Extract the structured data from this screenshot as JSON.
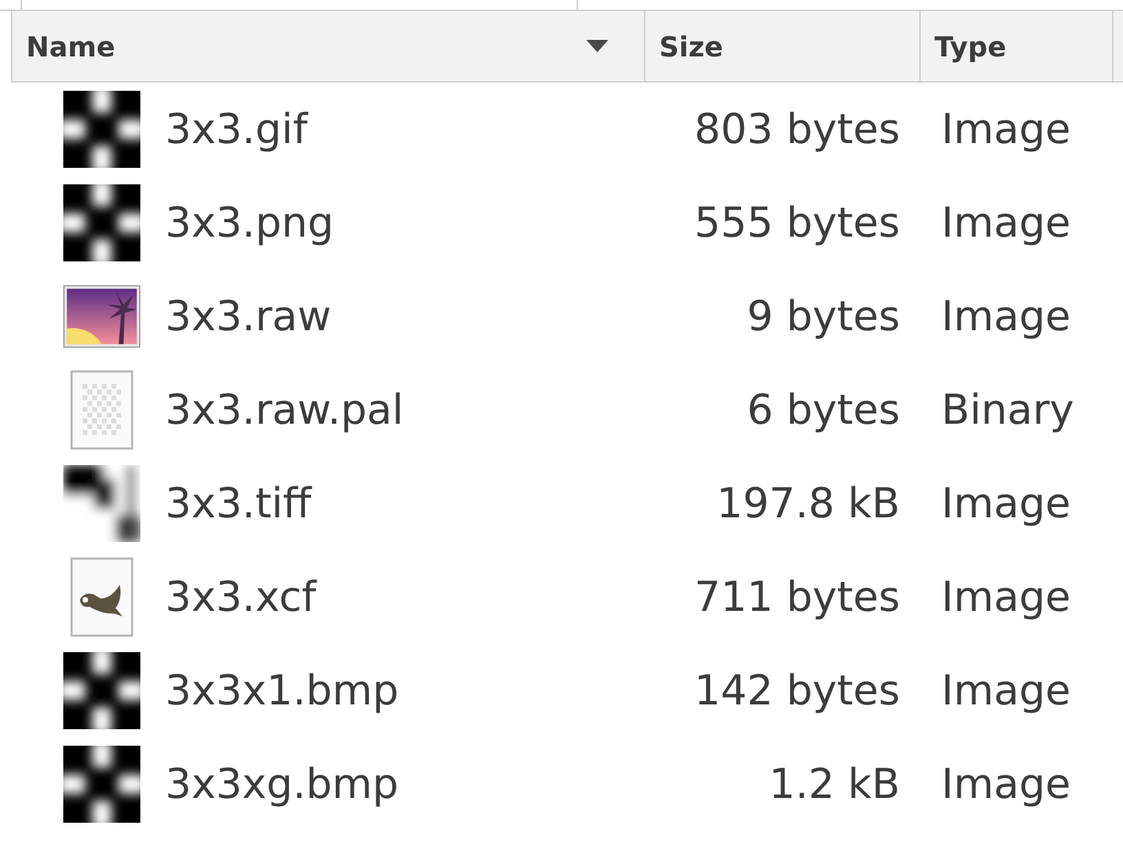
{
  "columns": [
    {
      "label": "Name",
      "sorted": true
    },
    {
      "label": "Size",
      "sorted": false
    },
    {
      "label": "Type",
      "sorted": false
    }
  ],
  "rows": [
    {
      "name": "3x3.gif",
      "size": "803 bytes",
      "type": "Image",
      "kind": "grid"
    },
    {
      "name": "3x3.png",
      "size": "555 bytes",
      "type": "Image",
      "kind": "grid"
    },
    {
      "name": "3x3.raw",
      "size": "9 bytes",
      "type": "Image",
      "kind": "picture"
    },
    {
      "name": "3x3.raw.pal",
      "size": "6 bytes",
      "type": "Binary",
      "kind": "blank"
    },
    {
      "name": "3x3.tiff",
      "size": "197.8 kB",
      "type": "Image",
      "kind": "corner"
    },
    {
      "name": "3x3.xcf",
      "size": "711 bytes",
      "type": "Image",
      "kind": "sketch"
    },
    {
      "name": "3x3x1.bmp",
      "size": "142 bytes",
      "type": "Image",
      "kind": "grid"
    },
    {
      "name": "3x3xg.bmp",
      "size": "1.2 kB",
      "type": "Image",
      "kind": "grid"
    }
  ]
}
